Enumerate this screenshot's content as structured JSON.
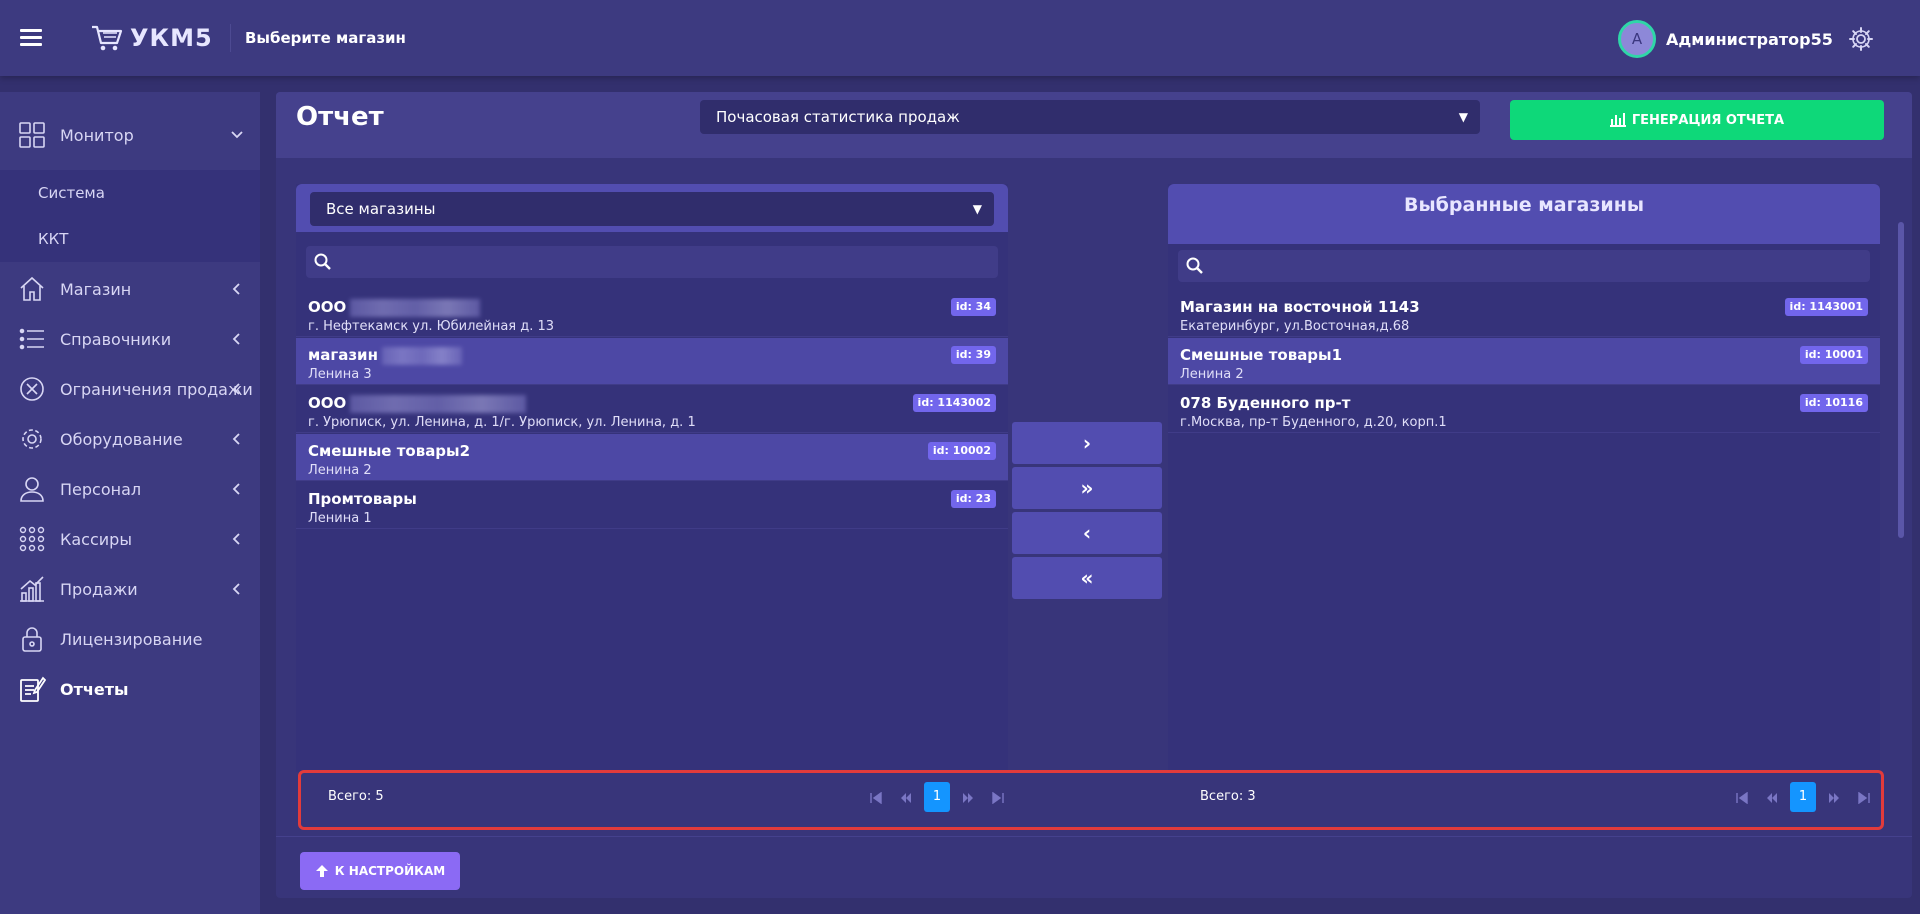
{
  "header": {
    "app_name": "УКМ5",
    "store_selector": "Выберите магазин",
    "user_initial": "А",
    "user_name": "Администратор55"
  },
  "sidebar": {
    "items": [
      {
        "label": "Монитор",
        "icon": "dashboard-icon"
      },
      {
        "label": "Магазин",
        "icon": "home-icon"
      },
      {
        "label": "Справочники",
        "icon": "list-icon"
      },
      {
        "label": "Ограничения продажи",
        "icon": "restrict-icon"
      },
      {
        "label": "Оборудование",
        "icon": "gear-icon"
      },
      {
        "label": "Персонал",
        "icon": "person-icon"
      },
      {
        "label": "Кассиры",
        "icon": "grid-dots-icon"
      },
      {
        "label": "Продажи",
        "icon": "sales-chart-icon"
      },
      {
        "label": "Лицензирование",
        "icon": "lock-icon"
      },
      {
        "label": "Отчеты",
        "icon": "report-icon"
      }
    ],
    "submenu": [
      "Система",
      "ККТ"
    ]
  },
  "main": {
    "title": "Отчет",
    "report_type": "Почасовая статистика продаж",
    "generate_label": "ГЕНЕРАЦИЯ ОТЧЕТА",
    "back_label": "К НАСТРОЙКАМ"
  },
  "left": {
    "filter": "Все магазины",
    "search_placeholder": "",
    "rows": [
      {
        "name": "ООО",
        "address": "г. Нефтекамск ул. Юбилейная д. 13",
        "id": "id: 34"
      },
      {
        "name": "магазин",
        "address": "Ленина 3",
        "id": "id: 39"
      },
      {
        "name": "ООО",
        "address": "г. Урюписк, ул. Ленина, д. 1/г. Урюписк, ул. Ленина, д. 1",
        "id": "id: 1143002"
      },
      {
        "name": "Смешные товары2",
        "address": "Ленина 2",
        "id": "id: 10002"
      },
      {
        "name": "Промтовары",
        "address": "Ленина 1",
        "id": "id: 23"
      }
    ],
    "total": "Всего: 5",
    "page": "1"
  },
  "right": {
    "title": "Выбранные магазины",
    "search_placeholder": "",
    "rows": [
      {
        "name": "Магазин на восточной 1143",
        "address": "Екатеринбург, ул.Восточная,д.68",
        "id": "id: 1143001"
      },
      {
        "name": "Смешные товары1",
        "address": "Ленина 2",
        "id": "id: 10001"
      },
      {
        "name": "078 Буденного пр-т",
        "address": "г.Москва, пр-т Буденного, д.20, корп.1",
        "id": "id: 10116"
      }
    ],
    "total": "Всего: 3",
    "page": "1"
  },
  "transfer": {
    "move_one": "›",
    "move_all": "»",
    "back_one": "‹",
    "back_all": "«"
  }
}
